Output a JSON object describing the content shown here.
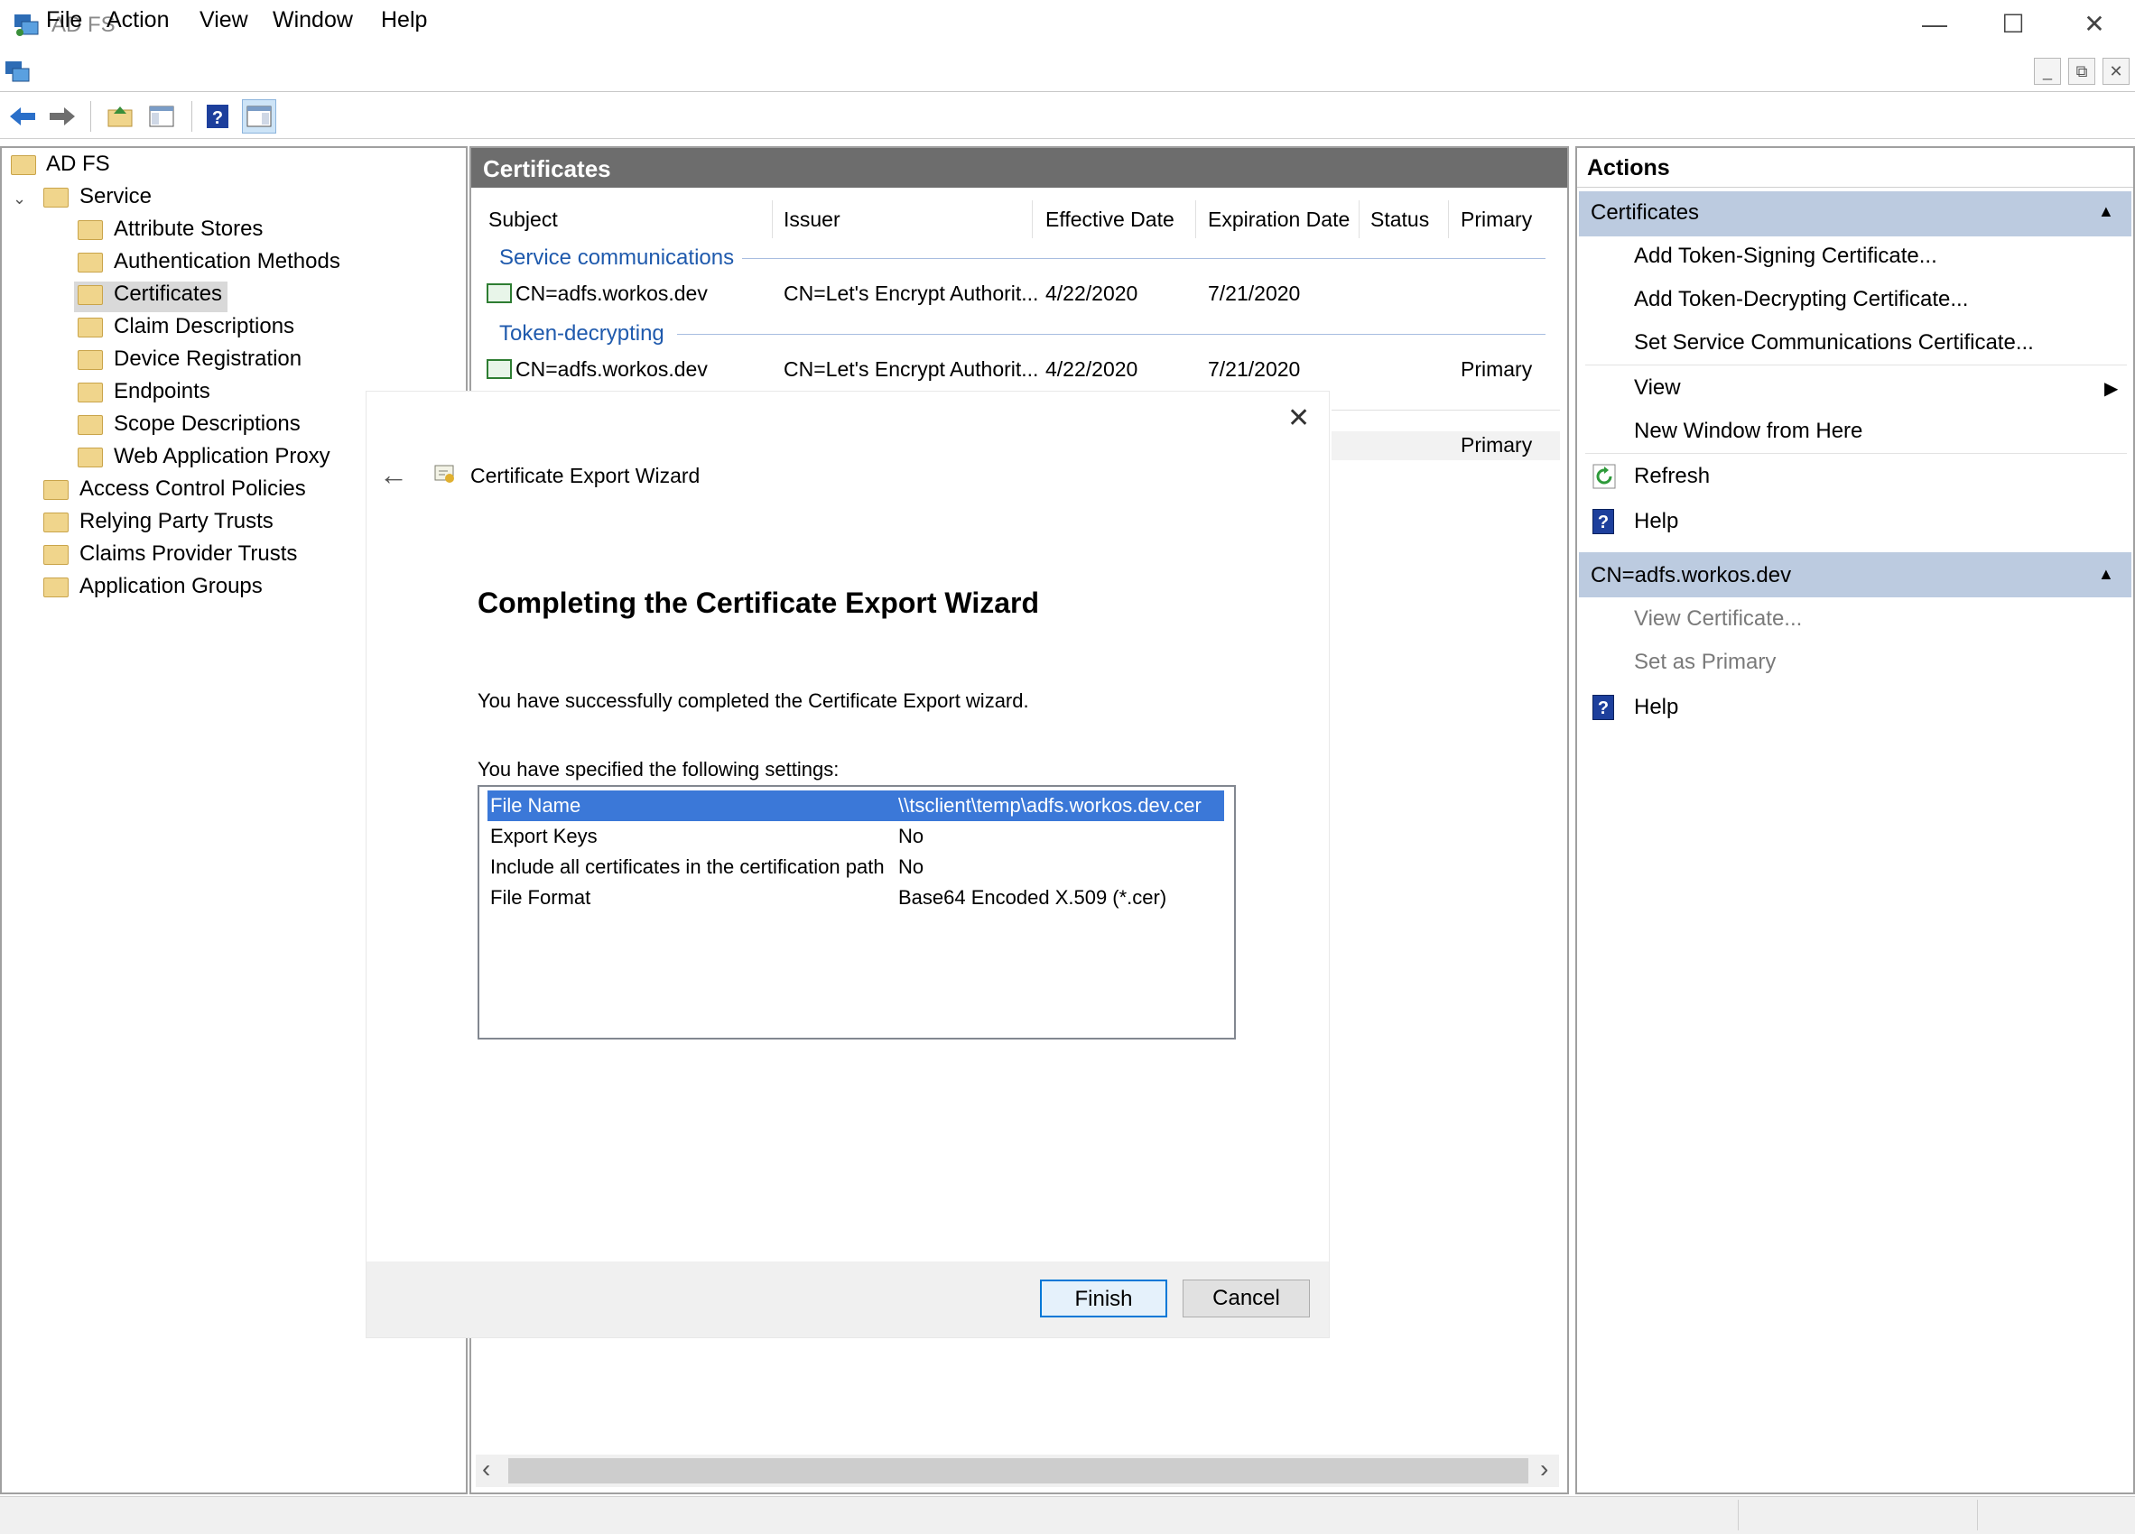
{
  "window": {
    "title": "AD FS",
    "minimize": "—",
    "maximize": "☐",
    "close": "✕"
  },
  "menu": [
    "File",
    "Action",
    "View",
    "Window",
    "Help"
  ],
  "mdi": {
    "min": "_",
    "restore": "⧉",
    "close": "✕"
  },
  "tree": {
    "root": "AD FS",
    "service": "Service",
    "service_children": [
      "Attribute Stores",
      "Authentication Methods",
      "Certificates",
      "Claim Descriptions",
      "Device Registration",
      "Endpoints",
      "Scope Descriptions",
      "Web Application Proxy"
    ],
    "other": [
      "Access Control Policies",
      "Relying Party Trusts",
      "Claims Provider Trusts",
      "Application Groups"
    ],
    "selected": "Certificates"
  },
  "center": {
    "title": "Certificates",
    "columns": [
      "Subject",
      "Issuer",
      "Effective Date",
      "Expiration Date",
      "Status",
      "Primary"
    ],
    "groups": [
      {
        "label": "Service communications",
        "row": {
          "subject": "CN=adfs.workos.dev",
          "issuer": "CN=Let's Encrypt Authorit...",
          "effective": "4/22/2020",
          "expiration": "7/21/2020",
          "status": "",
          "primary": ""
        }
      },
      {
        "label": "Token-decrypting",
        "row": {
          "subject": "CN=adfs.workos.dev",
          "issuer": "CN=Let's Encrypt Authorit...",
          "effective": "4/22/2020",
          "expiration": "7/21/2020",
          "status": "",
          "primary": "Primary"
        }
      }
    ],
    "partial_primary": "Primary",
    "scroll_left": "‹",
    "scroll_right": "›"
  },
  "actions": {
    "title": "Actions",
    "sections": [
      {
        "header": "Certificates",
        "items": [
          "Add Token-Signing Certificate...",
          "Add Token-Decrypting Certificate...",
          "Set Service Communications Certificate..."
        ],
        "view": "View",
        "new_window": "New Window from Here",
        "refresh": "Refresh",
        "help": "Help"
      },
      {
        "header": "CN=adfs.workos.dev",
        "items": [
          "View Certificate...",
          "Set as Primary"
        ],
        "help": "Help"
      }
    ],
    "collapse_glyph": "▲",
    "submenu_glyph": "▶"
  },
  "wizard": {
    "header": "Certificate Export Wizard",
    "back_glyph": "←",
    "close_glyph": "✕",
    "heading": "Completing the Certificate Export Wizard",
    "message": "You have successfully completed the Certificate Export wizard.",
    "settings_label": "You have specified the following settings:",
    "settings": [
      {
        "key": "File Name",
        "value": "\\\\tsclient\\temp\\adfs.workos.dev.cer"
      },
      {
        "key": "Export Keys",
        "value": "No"
      },
      {
        "key": "Include all certificates in the certification path",
        "value": "No"
      },
      {
        "key": "File Format",
        "value": "Base64 Encoded X.509 (*.cer)"
      }
    ],
    "finish": "Finish",
    "cancel": "Cancel"
  }
}
